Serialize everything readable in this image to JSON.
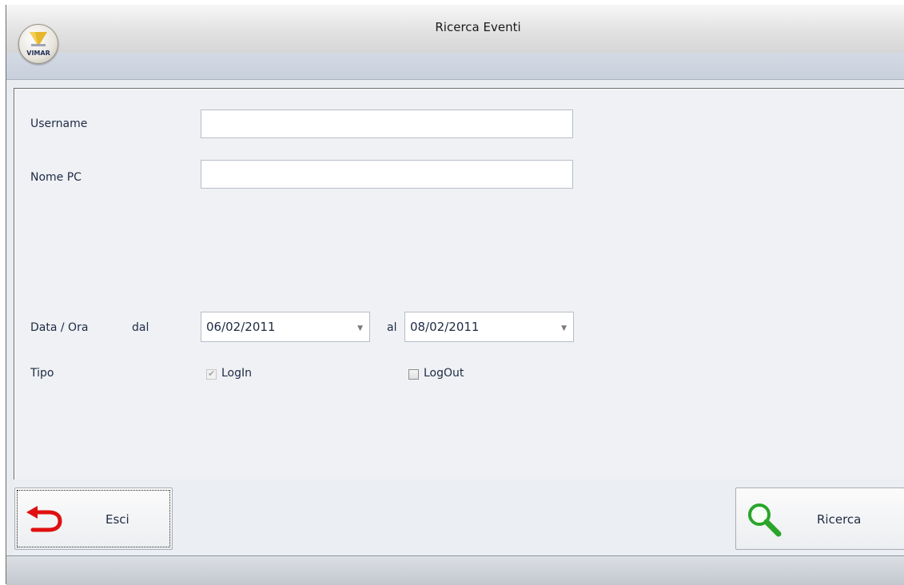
{
  "window": {
    "title": "Ricerca Eventi",
    "logo_text": "VIMAR"
  },
  "form": {
    "username": {
      "label": "Username",
      "value": ""
    },
    "pc_name": {
      "label": "Nome PC",
      "value": ""
    },
    "date_range": {
      "label": "Data / Ora",
      "from_label": "dal",
      "from_value": "06/02/2011",
      "to_label": "al",
      "to_value": "08/02/2011"
    },
    "type": {
      "label": "Tipo",
      "options": [
        {
          "label": "LogIn",
          "checked": true,
          "enabled": false
        },
        {
          "label": "LogOut",
          "checked": false,
          "enabled": true
        }
      ]
    }
  },
  "buttons": {
    "exit_label": "Esci",
    "search_label": "Ricerca"
  },
  "icons": {
    "logo": "vimar-logo-icon",
    "exit": "return-arrow-icon",
    "search": "magnifier-icon",
    "dropdown": "chevron-down-icon"
  },
  "colors": {
    "exit_icon": "#e01010",
    "search_icon": "#2aa52a"
  }
}
